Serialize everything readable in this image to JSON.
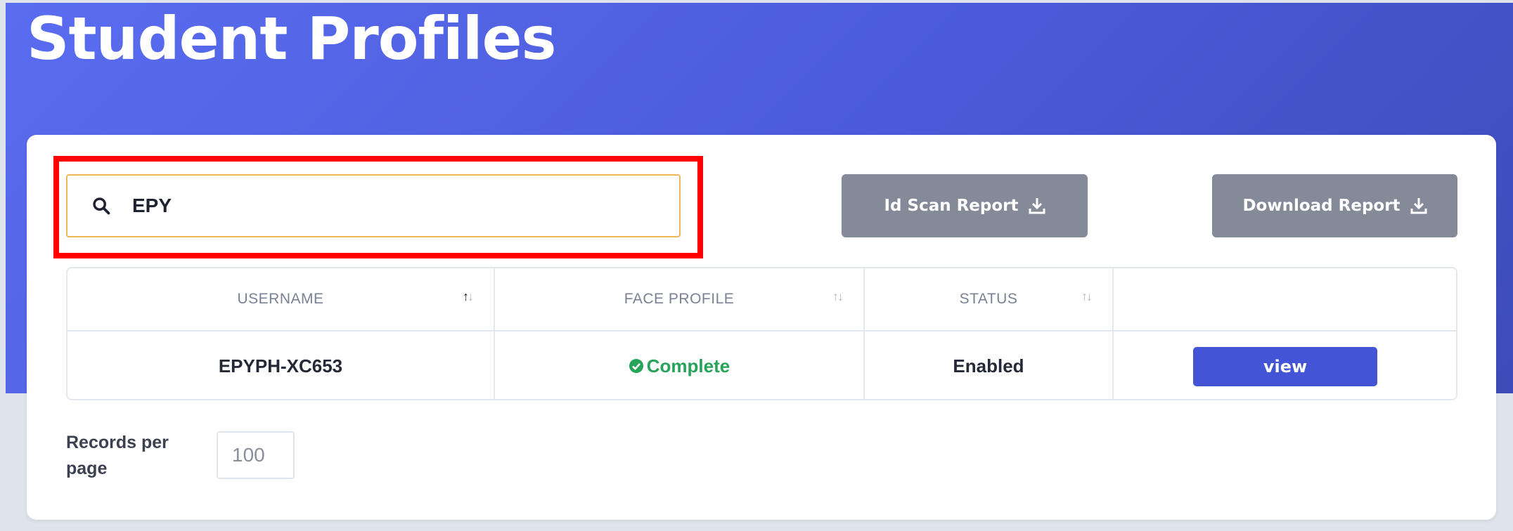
{
  "header": {
    "title": "Student Profiles"
  },
  "search": {
    "value": "EPY"
  },
  "toolbar": {
    "id_scan_label": "Id Scan Report",
    "download_label": "Download Report"
  },
  "table": {
    "columns": [
      {
        "label": "USERNAME",
        "sort": "ascending"
      },
      {
        "label": "FACE PROFILE",
        "sort": "none"
      },
      {
        "label": "STATUS",
        "sort": "none"
      },
      {
        "label": "",
        "sort": "none"
      }
    ],
    "rows": [
      {
        "username": "EPYPH-XC653",
        "face_profile": "Complete",
        "status": "Enabled",
        "action_label": "view"
      }
    ]
  },
  "pagination": {
    "records_label": "Records per page",
    "records_value": "100"
  },
  "colors": {
    "header_gradient": "#5a6cf0",
    "accent": "#4355d6",
    "success": "#27a35a",
    "secondary_button": "#858a99",
    "highlight": "#ff0000"
  },
  "icons": [
    "search-icon",
    "download-icon",
    "sort-icon",
    "check-circle-icon"
  ]
}
